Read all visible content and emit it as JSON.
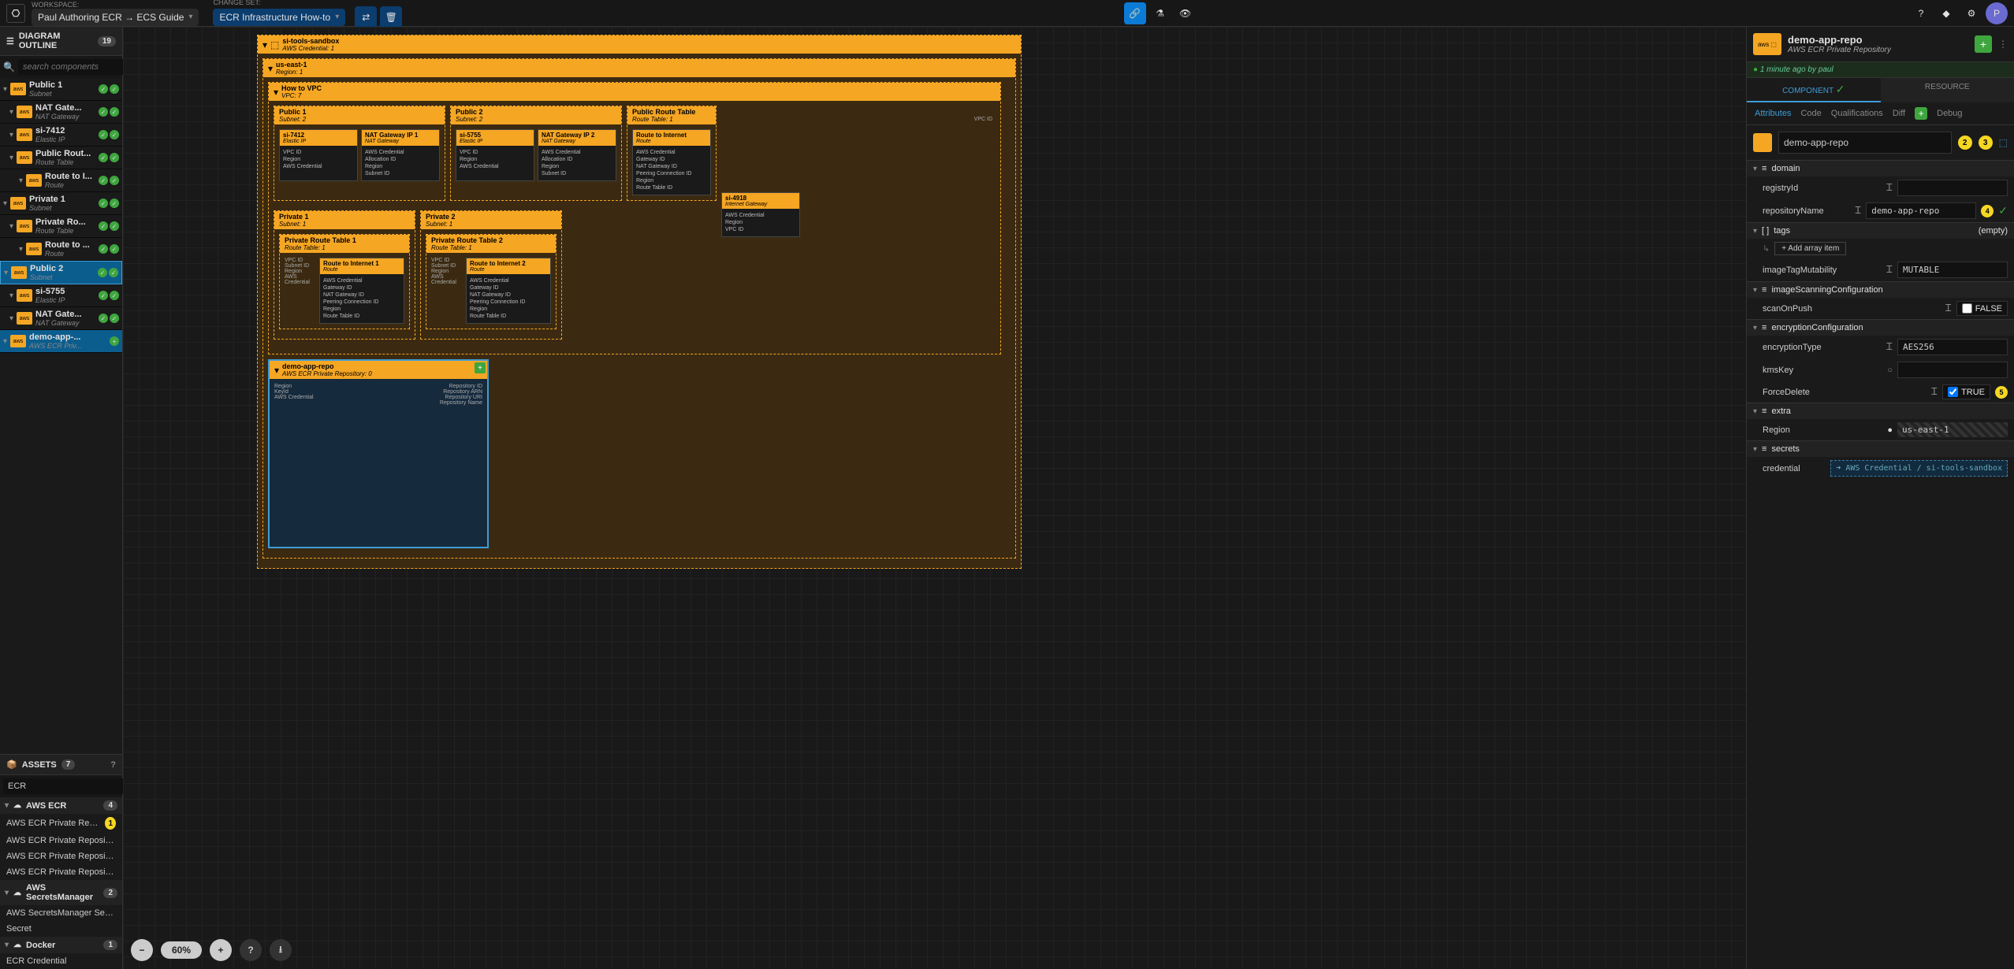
{
  "topbar": {
    "workspace_label": "WORKSPACE:",
    "workspace_value": "Paul Authoring ECR → ECS Guide",
    "changeset_label": "CHANGE SET:",
    "changeset_value": "ECR Infrastructure How-to"
  },
  "left": {
    "outline_title": "DIAGRAM OUTLINE",
    "outline_count": "19",
    "search_placeholder": "search components",
    "items": [
      {
        "title": "Public 1",
        "subtitle": "Subnet",
        "indent": 0,
        "selected": false
      },
      {
        "title": "NAT Gate...",
        "subtitle": "NAT Gateway",
        "indent": 1,
        "selected": false
      },
      {
        "title": "si-7412",
        "subtitle": "Elastic IP",
        "indent": 1,
        "selected": false
      },
      {
        "title": "Public Rout...",
        "subtitle": "Route Table",
        "indent": 1,
        "selected": false
      },
      {
        "title": "Route to I...",
        "subtitle": "Route",
        "indent": 2,
        "selected": false
      },
      {
        "title": "Private 1",
        "subtitle": "Subnet",
        "indent": 0,
        "selected": false
      },
      {
        "title": "Private Ro...",
        "subtitle": "Route Table",
        "indent": 1,
        "selected": false
      },
      {
        "title": "Route to ...",
        "subtitle": "Route",
        "indent": 2,
        "selected": false
      },
      {
        "title": "Public 2",
        "subtitle": "Subnet",
        "indent": 0,
        "selected": true
      },
      {
        "title": "si-5755",
        "subtitle": "Elastic IP",
        "indent": 1,
        "selected": false
      },
      {
        "title": "NAT Gate...",
        "subtitle": "NAT Gateway",
        "indent": 1,
        "selected": false
      },
      {
        "title": "demo-app-...",
        "subtitle": "AWS ECR Priv...",
        "indent": 0,
        "selected": false,
        "highlight": true,
        "plus": true
      }
    ],
    "assets_title": "ASSETS",
    "assets_count": "7",
    "assets_search": "ECR",
    "groups": [
      {
        "name": "AWS ECR",
        "count": "4",
        "items": [
          {
            "name": "AWS ECR Private Repository",
            "marker": "1"
          },
          {
            "name": "AWS ECR Private Repository Lifecycle ..."
          },
          {
            "name": "AWS ECR Private Repository Lifecycle ..."
          },
          {
            "name": "AWS ECR Private Repository Policy"
          }
        ]
      },
      {
        "name": "AWS SecretsManager",
        "count": "2",
        "items": [
          {
            "name": "AWS SecretsManager Secret String"
          },
          {
            "name": "Secret"
          }
        ]
      },
      {
        "name": "Docker",
        "count": "1",
        "items": [
          {
            "name": "ECR Credential"
          }
        ]
      }
    ]
  },
  "canvas": {
    "root": {
      "title": "si-tools-sandbox",
      "subtitle": "AWS Credential: 1"
    },
    "region": {
      "title": "us-east-1",
      "subtitle": "Region: 1"
    },
    "vpc": {
      "title": "How to VPC",
      "subtitle": "VPC: 7"
    },
    "public1": {
      "title": "Public 1",
      "subtitle": "Subnet: 2"
    },
    "public2_top": {
      "title": "Public 2",
      "subtitle": "Subnet: 2"
    },
    "public_rt": {
      "title": "Public Route Table",
      "subtitle": "Route Table: 1"
    },
    "route_internet": {
      "title": "Route to Internet",
      "subtitle": "Route"
    },
    "nat1": {
      "title": "NAT Gateway IP 1",
      "subtitle": "NAT Gateway"
    },
    "nat2": {
      "title": "NAT Gateway IP 2",
      "subtitle": "NAT Gateway"
    },
    "si7412": {
      "title": "si-7412",
      "subtitle": "Elastic IP"
    },
    "si5755": {
      "title": "si-5755",
      "subtitle": "Elastic IP"
    },
    "si4918": {
      "title": "si-4918",
      "subtitle": "Internet Gateway"
    },
    "private1": {
      "title": "Private 1",
      "subtitle": "Subnet: 1"
    },
    "private2": {
      "title": "Private 2",
      "subtitle": "Subnet: 1"
    },
    "prt1": {
      "title": "Private Route Table 1",
      "subtitle": "Route Table: 1"
    },
    "prt2": {
      "title": "Private Route Table 2",
      "subtitle": "Route Table: 1"
    },
    "rti1": {
      "title": "Route to Internet 1",
      "subtitle": "Route"
    },
    "rti2": {
      "title": "Route to Internet 2",
      "subtitle": "Route"
    },
    "demo": {
      "title": "demo-app-repo",
      "subtitle": "AWS ECR Private Repository: 0"
    },
    "tiny_labels": {
      "region": "Region",
      "vpc_id": "VPC ID",
      "aws_cred": "AWS Credential",
      "allocation_id": "Allocation ID",
      "subnet_id": "Subnet ID",
      "gateway_id": "Gateway ID",
      "nat_gateway_id": "NAT Gateway ID",
      "peering_conn": "Peering Connection ID",
      "route_table_id": "Route Table ID",
      "key_id": "KeyId",
      "repository_id": "Repository ID",
      "repository_arn": "Repository ARN",
      "repository_uri": "Repository URI",
      "repository_name": "Repository Name"
    },
    "zoom": "60%"
  },
  "right": {
    "title": "demo-app-repo",
    "subtitle": "AWS ECR Private Repository",
    "meta": "1 minute ago by paul",
    "tabs": {
      "component": "COMPONENT",
      "resource": "RESOURCE"
    },
    "subtabs": {
      "attributes": "Attributes",
      "code": "Code",
      "qualifications": "Qualifications",
      "diff": "Diff",
      "debug": "Debug"
    },
    "name_value": "demo-app-repo",
    "marker2": "2",
    "marker3": "3",
    "sections": {
      "domain": "domain",
      "tags": "tags",
      "tags_empty": "(empty)",
      "add_array": "+ Add array item",
      "imageScanning": "imageScanningConfiguration",
      "encryption": "encryptionConfiguration",
      "extra": "extra",
      "secrets": "secrets"
    },
    "attrs": {
      "registryId": {
        "label": "registryId",
        "value": ""
      },
      "repositoryName": {
        "label": "repositoryName",
        "value": "demo-app-repo",
        "marker": "4"
      },
      "imageTagMutability": {
        "label": "imageTagMutability",
        "value": "MUTABLE"
      },
      "scanOnPush": {
        "label": "scanOnPush",
        "value": "FALSE"
      },
      "encryptionType": {
        "label": "encryptionType",
        "value": "AES256"
      },
      "kmsKey": {
        "label": "kmsKey",
        "value": ""
      },
      "forceDelete": {
        "label": "ForceDelete",
        "value": "TRUE",
        "marker": "5"
      },
      "region": {
        "label": "Region",
        "value": "us-east-1"
      },
      "credential": {
        "label": "credential",
        "value": "➜ AWS Credential / si-tools-sandbox"
      }
    }
  }
}
